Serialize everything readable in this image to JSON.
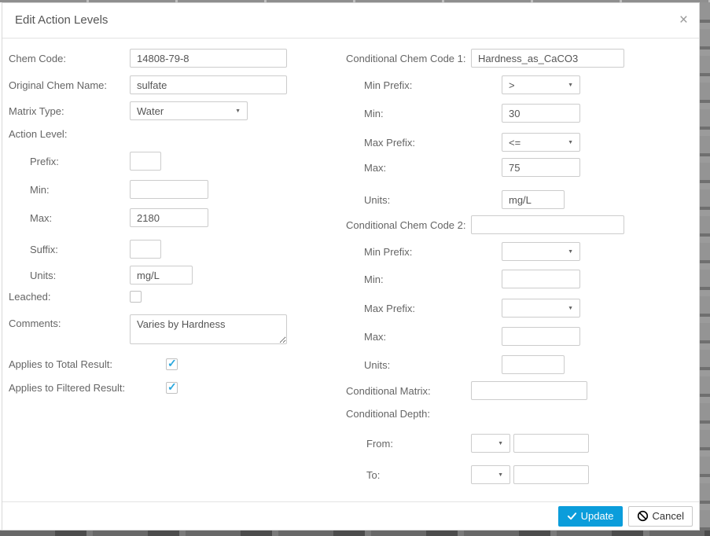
{
  "dialog": {
    "title": "Edit Action Levels"
  },
  "icons": {
    "close": "×",
    "dropdown_arrow": "▼",
    "check": "✓"
  },
  "left": {
    "chem_code": {
      "label": "Chem Code:",
      "value": "14808-79-8"
    },
    "original_chem_name": {
      "label": "Original Chem Name:",
      "value": "sulfate"
    },
    "matrix_type": {
      "label": "Matrix Type:",
      "value": "Water"
    },
    "action_level": {
      "label": "Action Level:"
    },
    "prefix": {
      "label": "Prefix:",
      "value": ""
    },
    "min": {
      "label": "Min:",
      "value": ""
    },
    "max": {
      "label": "Max:",
      "value": "2180"
    },
    "suffix": {
      "label": "Suffix:",
      "value": ""
    },
    "units": {
      "label": "Units:",
      "value": "mg/L"
    },
    "leached": {
      "label": "Leached:",
      "checked": false
    },
    "comments": {
      "label": "Comments:",
      "value": "Varies by Hardness"
    },
    "applies_total": {
      "label": "Applies to Total Result:",
      "checked": true
    },
    "applies_filtered": {
      "label": "Applies to Filtered Result:",
      "checked": true
    }
  },
  "right": {
    "cond_chem_code_1": {
      "label": "Conditional Chem Code 1:",
      "value": "Hardness_as_CaCO3"
    },
    "min_prefix_1": {
      "label": "Min Prefix:",
      "value": ">"
    },
    "min_1": {
      "label": "Min:",
      "value": "30"
    },
    "max_prefix_1": {
      "label": "Max Prefix:",
      "value": "<="
    },
    "max_1": {
      "label": "Max:",
      "value": "75"
    },
    "units_1": {
      "label": "Units:",
      "value": "mg/L"
    },
    "cond_chem_code_2": {
      "label": "Conditional Chem Code 2:",
      "value": ""
    },
    "min_prefix_2": {
      "label": "Min Prefix:",
      "value": ""
    },
    "min_2": {
      "label": "Min:",
      "value": ""
    },
    "max_prefix_2": {
      "label": "Max Prefix:",
      "value": ""
    },
    "max_2": {
      "label": "Max:",
      "value": ""
    },
    "units_2": {
      "label": "Units:",
      "value": ""
    },
    "cond_matrix": {
      "label": "Conditional Matrix:",
      "value": ""
    },
    "cond_depth": {
      "label": "Conditional Depth:"
    },
    "from": {
      "label": "From:",
      "unit": "",
      "value": ""
    },
    "to": {
      "label": "To:",
      "unit": "",
      "value": ""
    }
  },
  "footer": {
    "update": "Update",
    "cancel": "Cancel"
  },
  "colors": {
    "primary": "#0b9ddb",
    "check": "#2aa7dd"
  }
}
